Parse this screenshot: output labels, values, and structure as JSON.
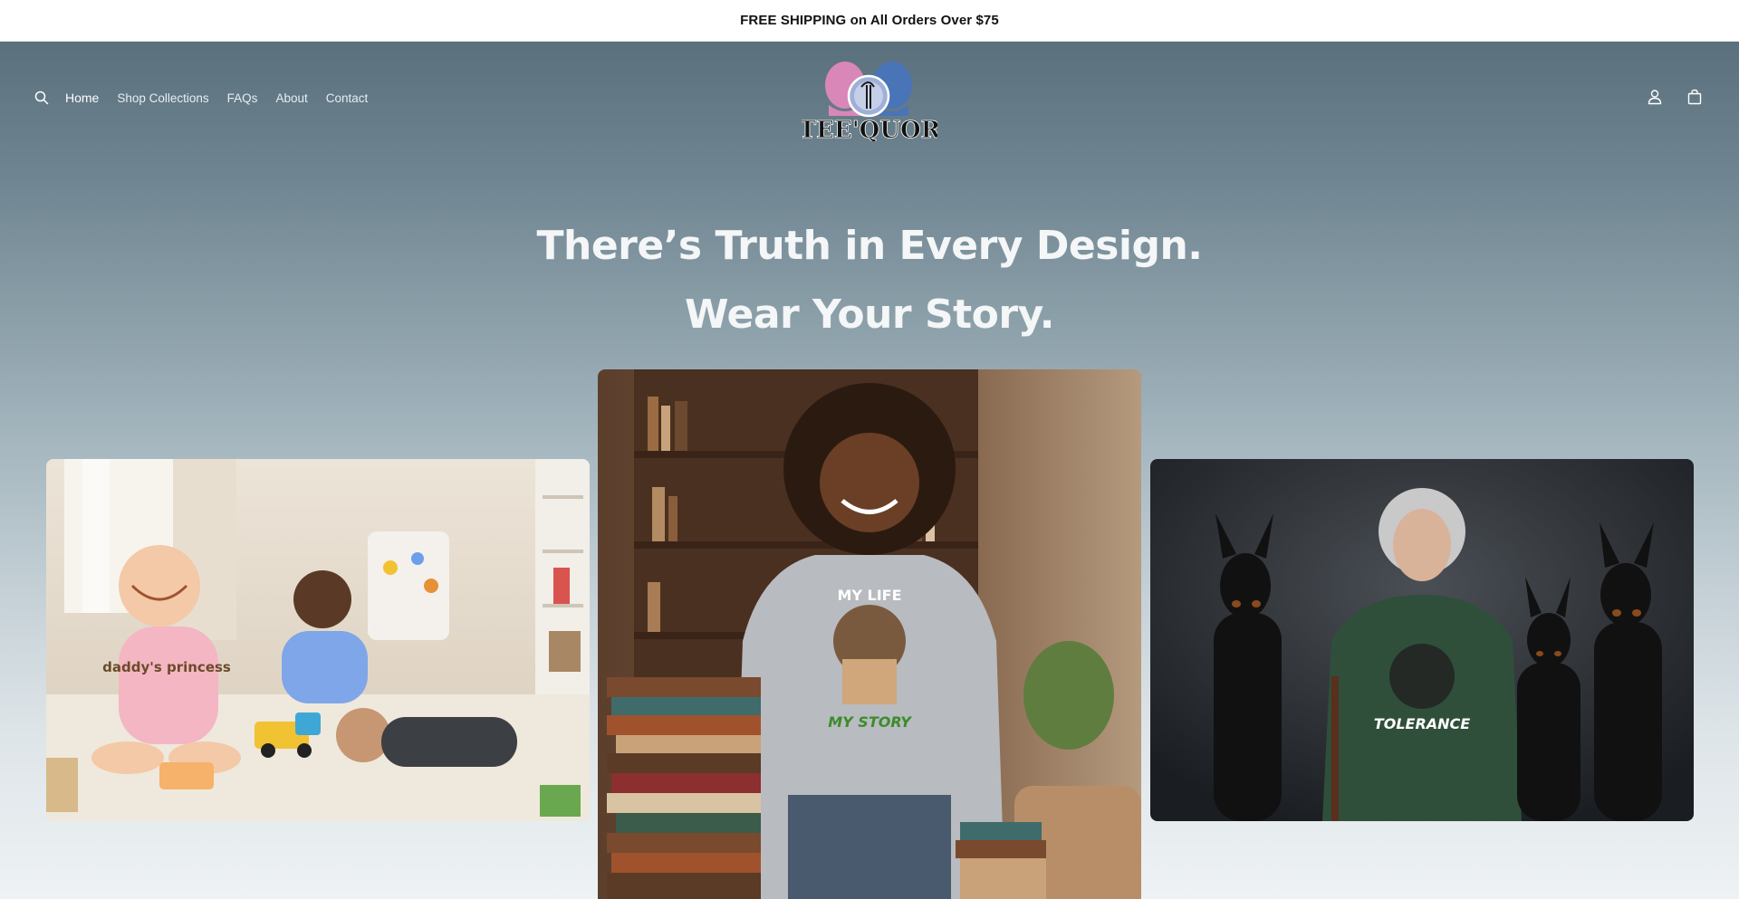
{
  "announcement": {
    "text": "FREE SHIPPING on All Orders Over $75"
  },
  "header": {
    "nav": [
      {
        "label": "Home"
      },
      {
        "label": "Shop Collections"
      },
      {
        "label": "FAQs"
      },
      {
        "label": "About"
      },
      {
        "label": "Contact"
      }
    ],
    "logo_text": "TEE'QUOR",
    "icons": {
      "search": "search-icon",
      "account": "account-icon",
      "cart": "cart-icon"
    }
  },
  "hero": {
    "headline_1": "There’s Truth in Every Design.",
    "headline_2": "Wear Your Story.",
    "images": {
      "left": {
        "shirt_text": "daddy's princess"
      },
      "center": {
        "shirt_text_top": "MY LIFE",
        "shirt_text_bottom": "MY STORY"
      },
      "right": {
        "shirt_text": "TOLERANCE"
      }
    }
  },
  "colors": {
    "hero_top": "#5a707d",
    "hero_bottom": "#eef2f4",
    "headline": "#f4f6f7"
  }
}
